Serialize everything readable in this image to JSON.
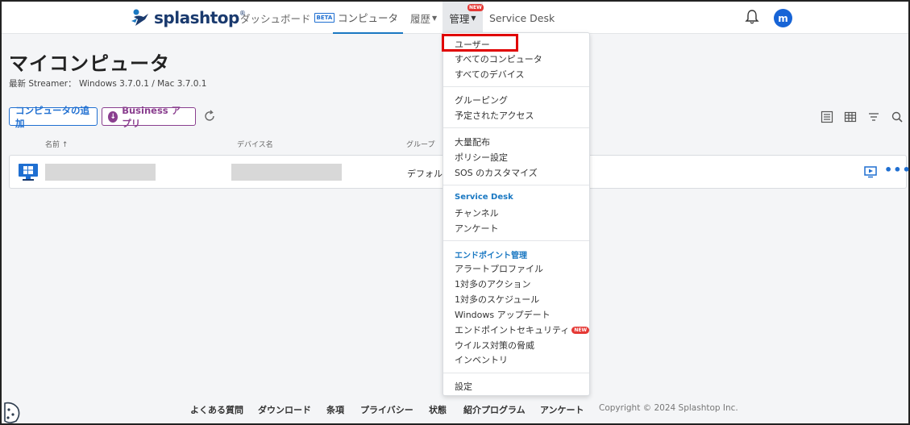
{
  "nav": {
    "logo_text": "splashtop",
    "dashboard": "ダッシュボード",
    "beta": "BETA",
    "computers": "コンピュータ",
    "history": "履歴",
    "admin": "管理",
    "admin_badge": "NEW",
    "service_desk": "Service Desk",
    "avatar_initial": "m"
  },
  "page": {
    "title": "マイコンピュータ",
    "streamer_line": "最新 Streamer： Windows 3.7.0.1 / Mac 3.7.0.1",
    "add_button": "コンピュータの追加",
    "business_button": "Business アプリ"
  },
  "table": {
    "columns": [
      "名前 ↑",
      "デバイス名",
      "グループ"
    ],
    "rows": [
      {
        "name": "",
        "device": "",
        "group": "デフォル"
      }
    ]
  },
  "dropdown": {
    "section1": [
      "ユーザー",
      "すべてのコンピュータ",
      "すべてのデバイス"
    ],
    "section2": [
      "グルーピング",
      "予定されたアクセス"
    ],
    "section3": [
      "大量配布",
      "ポリシー設定",
      "SOS のカスタマイズ"
    ],
    "section4_header": "Service Desk",
    "section4": [
      "チャンネル",
      "アンケート"
    ],
    "section5_header": "エンドポイント管理",
    "section5": [
      "アラートプロファイル",
      "1対多のアクション",
      "1対多のスケジュール",
      "Windows アップデート",
      "エンドポイントセキュリティ",
      "ウイルス対策の脅威",
      "インベントリ"
    ],
    "security_badge": "NEW",
    "section6": [
      "設定"
    ]
  },
  "footer": {
    "links": [
      "よくある質問",
      "ダウンロード",
      "条項",
      "プライバシー",
      "状態",
      "紹介プログラム",
      "アンケート"
    ],
    "copyright": "Copyright © 2024 Splashtop Inc."
  },
  "colors": {
    "accent": "#1f6fd1",
    "business": "#8a3f8f",
    "highlight": "#e00000",
    "badge": "#e53935"
  }
}
